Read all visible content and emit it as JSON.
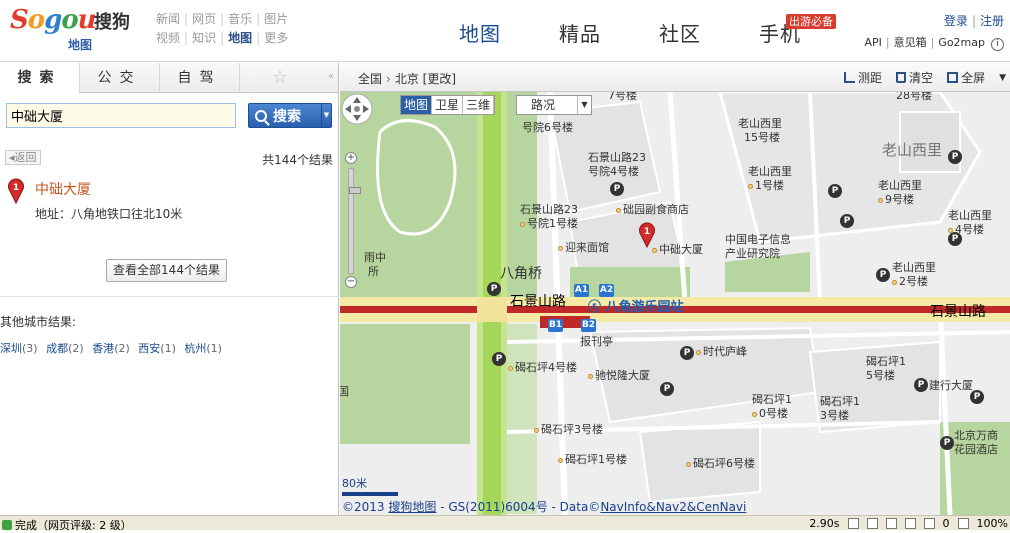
{
  "header": {
    "logo_text": "Sogou",
    "logo_cn": "搜狗",
    "logo_sub": "地图",
    "search_nav_row1": [
      "新闻",
      "网页",
      "音乐",
      "图片"
    ],
    "search_nav_row2": [
      "视频",
      "知识",
      "地图",
      "更多"
    ],
    "search_nav_current": "地图",
    "main_nav": [
      "地图",
      "精品",
      "社区",
      "手机"
    ],
    "main_nav_active": "地图",
    "mobile_badge": "出游必备",
    "login": "登录",
    "register": "注册",
    "links": [
      "API",
      "意见箱",
      "Go2map"
    ],
    "info": "i"
  },
  "left": {
    "tabs": [
      "搜索",
      "公交",
      "自驾"
    ],
    "active_tab": "搜索",
    "star": "☆",
    "collapse": "«",
    "search_value": "中础大厦",
    "search_button": "搜索",
    "back": "返回",
    "result_count": "共144个结果",
    "result": {
      "index": "1",
      "title": "中础大厦",
      "address": "地址：八角地铁口往北10米"
    },
    "view_all": "查看全部144个结果",
    "other_title": "其他城市结果:",
    "other_cities": [
      {
        "name": "深圳",
        "count": "(3)"
      },
      {
        "name": "成都",
        "count": "(2)"
      },
      {
        "name": "香港",
        "count": "(2)"
      },
      {
        "name": "西安",
        "count": "(1)"
      },
      {
        "name": "杭州",
        "count": "(1)"
      }
    ]
  },
  "toolbar": {
    "crumb_all": "全国",
    "crumb_city": "北京",
    "crumb_change": "[更改]",
    "ruler": "测距",
    "clear": "清空",
    "fullscreen": "全屏"
  },
  "map": {
    "types": [
      "地图",
      "卫星",
      "三维"
    ],
    "active_type": "地图",
    "traffic": "路况",
    "scale": "80米",
    "copyright_pre": "©2013 ",
    "copyright_brand": "搜狗地图",
    "copyright_mid": " - GS(2011)6004号 - Data©",
    "copyright_links": "NavInfo&Nav2&CenNavi",
    "labels": {
      "laoshan_west": "老山西里",
      "bajiaoqiao": "八角桥",
      "shijingshan_road_w": "石景山路",
      "shijingshan_road_e": "石景山路",
      "station": "八角游乐园站",
      "zhongchu": "中础大厦",
      "bao_kan_ting": "报刊亭",
      "comp1": "中国电子信息",
      "comp2": "产业研究院",
      "shijing23a": "石景山路23",
      "shijing23a2": "号院4号楼",
      "shijing23b": "石景山路23",
      "shijing23b2": "号院1号楼",
      "yulai": "迎来面馆",
      "shi7": "7号楼",
      "yuan6": "号院6号楼",
      "chudi": "础园副食商店",
      "ls15a": "老山西里",
      "ls15b": "15号楼",
      "ls1a": "老山西里",
      "ls1b": "1号楼",
      "ls9a": "老山西里",
      "ls9b": "9号楼",
      "ls4a": "老山西里",
      "ls4b": "4号楼",
      "ls2a": "老山西里",
      "ls2b": "2号楼",
      "ls28": "28号楼",
      "yutong": "雨中",
      "suo": "所",
      "shidai": "时代庐峰",
      "zhixiang": "驰悦隆大厦",
      "qshi4": "碣石坪4号楼",
      "qshi1a": "碣石坪1",
      "qshi1b": "5号楼",
      "jiancai": "建行大厦",
      "qshi0a": "碣石坪1",
      "qshi0b": "0号楼",
      "qshi3a": "碣石坪1",
      "qshi3b": "3号楼",
      "qshi3": "碣石坪3号楼",
      "qshi1": "碣石坪1号楼",
      "qshi6": "碣石坪6号楼",
      "wanguo1": "北京万商",
      "wanguo2": "花园酒店",
      "guo": "国",
      "exits": [
        "A1",
        "A2",
        "B1",
        "B2"
      ]
    }
  },
  "status": {
    "text": "完成（网页评级: 2 级）",
    "time": "2.90s",
    "zero": "0",
    "zoom": "100%"
  },
  "colors": {
    "accent_blue": "#1a4c94",
    "road_red": "#c0282a",
    "green": "#b5d39c",
    "highway_green": "#a6d96a"
  }
}
